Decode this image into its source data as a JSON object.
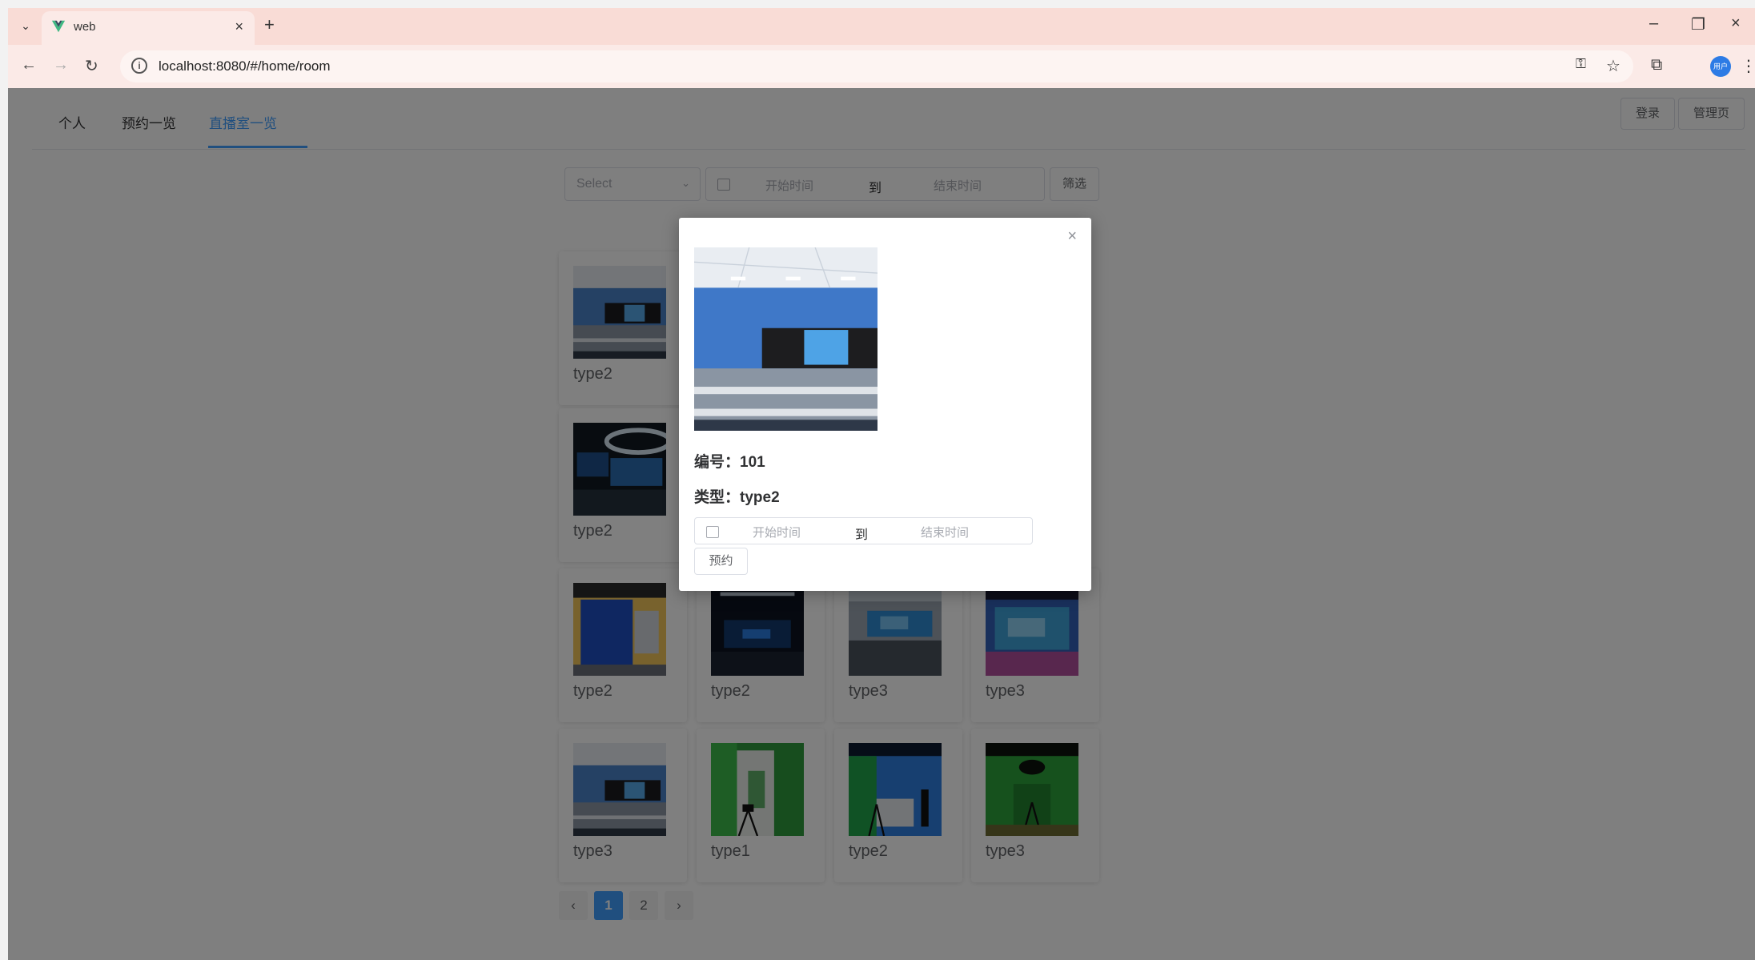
{
  "browser": {
    "tab_title": "web",
    "url": "localhost:8080/#/home/room",
    "profile_initials": "用户"
  },
  "nav": {
    "menu": [
      "个人",
      "预约一览",
      "直播室一览"
    ],
    "active_index": 2,
    "login_label": "登录",
    "admin_label": "管理页"
  },
  "filter": {
    "select_placeholder": "Select",
    "start_placeholder": "开始时间",
    "separator": "到",
    "end_placeholder": "结束时间",
    "filter_button": "筛选"
  },
  "rooms": [
    {
      "type": "type2",
      "scene": "classroom"
    },
    {
      "type": "type2",
      "scene": "studio"
    },
    {
      "type": "type2",
      "scene": "blue"
    },
    {
      "type": "type2",
      "scene": "dark"
    },
    {
      "type": "type3",
      "scene": "gray"
    },
    {
      "type": "type3",
      "scene": "screen"
    },
    {
      "type": "type3",
      "scene": "classroom"
    },
    {
      "type": "type1",
      "scene": "greenscreen"
    },
    {
      "type": "type2",
      "scene": "bluescreen"
    },
    {
      "type": "type3",
      "scene": "green"
    }
  ],
  "pagination": {
    "pages": [
      "1",
      "2"
    ],
    "current": "1"
  },
  "dialog": {
    "number_label": "编号：",
    "number_value": "101",
    "type_label": "类型：",
    "type_value": "type2",
    "start_placeholder": "开始时间",
    "separator": "到",
    "end_placeholder": "结束时间",
    "reserve_button": "预约"
  },
  "colors": {
    "accent": "#409eff",
    "tabstrip": "#f9dcd6"
  }
}
